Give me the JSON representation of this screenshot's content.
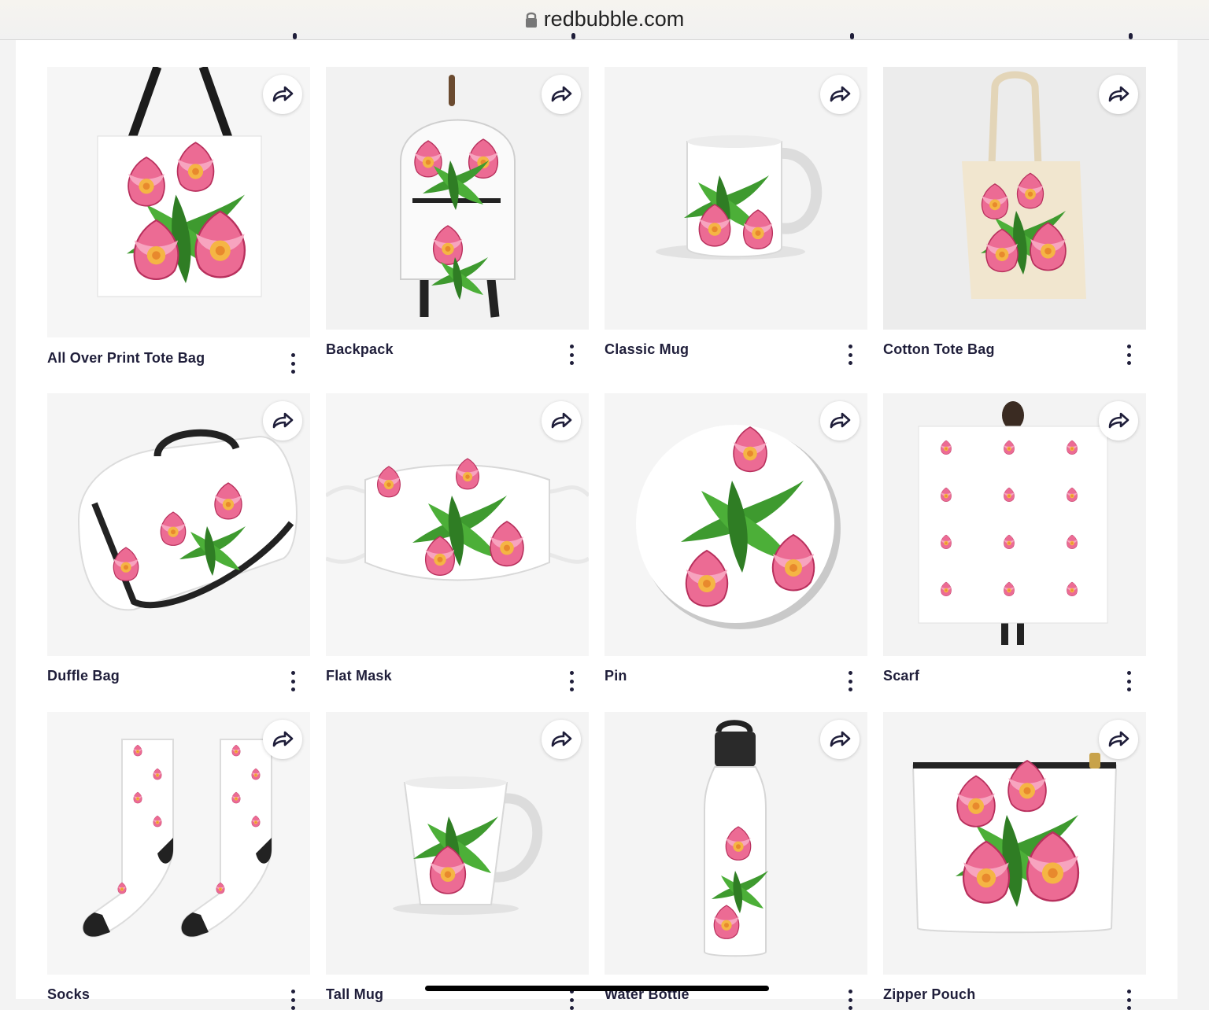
{
  "browser": {
    "url": "redbubble.com"
  },
  "colors": {
    "text": "#1f1e3a",
    "petal": "#ec6b94",
    "leaf": "#3e9a2f",
    "center": "#f5b544"
  },
  "products": [
    {
      "title": "All Over Print Tote Bag",
      "share_icon": "share-arrow-icon"
    },
    {
      "title": "Backpack",
      "share_icon": "share-arrow-icon"
    },
    {
      "title": "Classic Mug",
      "share_icon": "share-arrow-icon"
    },
    {
      "title": "Cotton Tote Bag",
      "share_icon": "share-arrow-icon"
    },
    {
      "title": "Duffle Bag",
      "share_icon": "share-arrow-icon"
    },
    {
      "title": "Flat Mask",
      "share_icon": "share-arrow-icon"
    },
    {
      "title": "Pin",
      "share_icon": "share-arrow-icon"
    },
    {
      "title": "Scarf",
      "share_icon": "share-arrow-icon"
    },
    {
      "title": "Socks",
      "share_icon": "share-arrow-icon"
    },
    {
      "title": "Tall Mug",
      "share_icon": "share-arrow-icon"
    },
    {
      "title": "Water Bottle",
      "share_icon": "share-arrow-icon"
    },
    {
      "title": "Zipper Pouch",
      "share_icon": "share-arrow-icon"
    }
  ]
}
